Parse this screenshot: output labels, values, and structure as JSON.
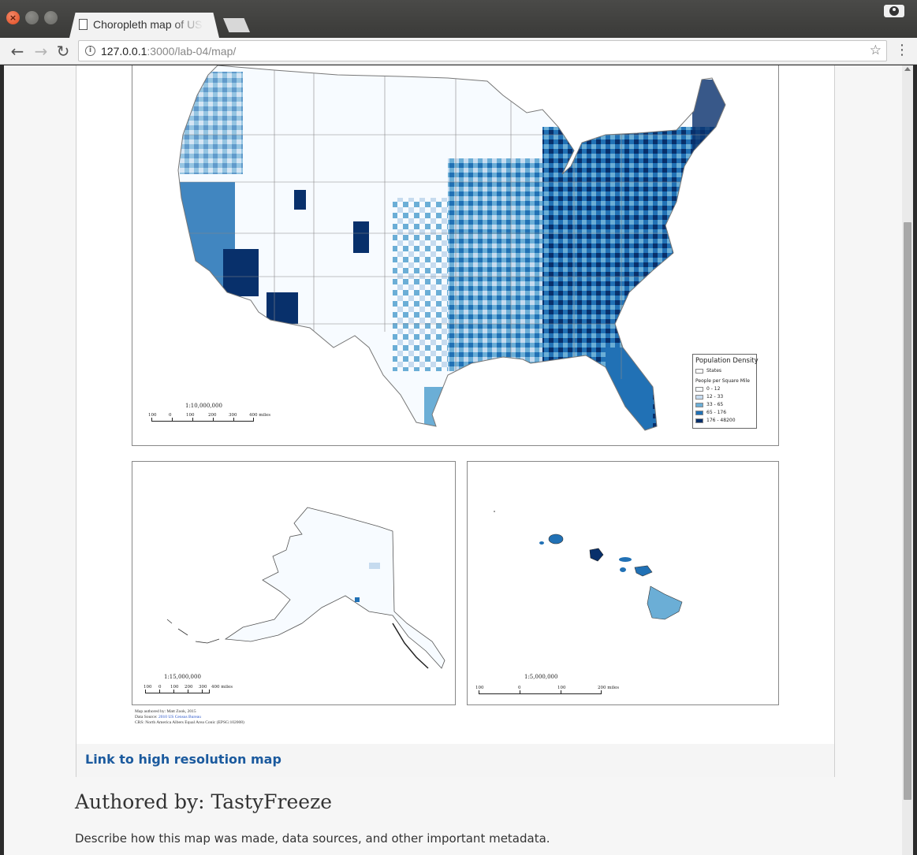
{
  "window": {
    "close_glyph": "×",
    "tab_title": "Choropleth map of US Population Density"
  },
  "toolbar": {
    "url_host": "127.0.0.1",
    "url_rest": ":3000/lab-04/map/",
    "back_glyph": "←",
    "forward_glyph": "→",
    "reload_glyph": "↻",
    "star_glyph": "☆",
    "menu_glyph": "⋮",
    "info_glyph": "i"
  },
  "map": {
    "main_scale": "1:10,000,000",
    "main_scale_nums": [
      "100",
      "0",
      "100",
      "200",
      "300",
      "400 miles"
    ],
    "ak_scale": "1:15,000,000",
    "ak_scale_nums": [
      "100",
      "0",
      "100",
      "200",
      "300",
      "400 miles"
    ],
    "hi_scale": "1:5,000,000",
    "hi_scale_nums": [
      "100",
      "0",
      "100",
      "200 miles"
    ],
    "legend": {
      "title": "Population Density",
      "states_label": "States",
      "subtitle": "People per Square Mile",
      "classes": [
        {
          "label": "0 - 12",
          "color": "#f7fbff"
        },
        {
          "label": "12 - 33",
          "color": "#c6dbef"
        },
        {
          "label": "33 - 65",
          "color": "#6baed6"
        },
        {
          "label": "65 - 176",
          "color": "#2171b5"
        },
        {
          "label": "176 - 48200",
          "color": "#08306b"
        }
      ]
    },
    "credits": {
      "line1": "Map authored by: Matt Zook, 2015",
      "line2_prefix": "Data Source:",
      "line2_link": "2010 US Census Bureau",
      "line3": "CRS: North America Albers Equal Area Conic (EPSG:102008)"
    },
    "link_label": "Link to high resolution map"
  },
  "page": {
    "author_heading": "Authored by: TastyFreeze",
    "description": "Describe how this map was made, data sources, and other important metadata."
  }
}
